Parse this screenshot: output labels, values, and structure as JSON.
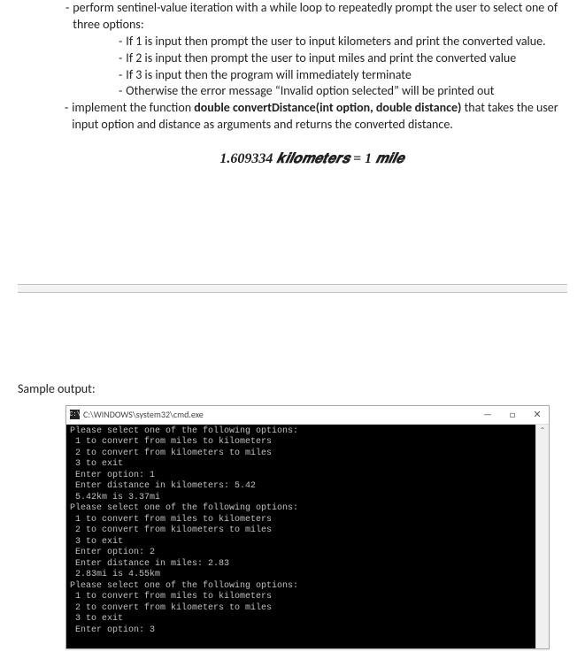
{
  "instructions": {
    "main1": "perform sentinel-value iteration with a while loop to repeatedly prompt the user to select one of three options:",
    "sub1": "If 1 is input then prompt the user to input kilometers and print the converted value.",
    "sub2": "If 2 is input then prompt the user to input miles and print the converted value",
    "sub3": "If 3 is input then the program will immediately terminate",
    "sub4": "Otherwise the error message “Invalid option selected” will be printed out",
    "main2_prefix": "implement the function ",
    "main2_bold": "double convertDistance(int option, double distance)",
    "main2_suffix": " that takes the user input option and distance as arguments and returns the converted distance."
  },
  "formula": "1.609334 𝒌𝒊𝒍𝒐𝒎𝒆𝒕𝒆𝒓𝒔 = 1 𝒎𝒊𝒍𝒆",
  "sample_label": "Sample output:",
  "console": {
    "icon_text": "C:\\",
    "title": "C:\\WINDOWS\\system32\\cmd.exe",
    "minimize": "—",
    "maximize": "□",
    "close": "✕",
    "scroll_up": "⌃",
    "lines": [
      "Please select one of the following options:",
      " 1 to convert from miles to kilometers",
      " 2 to convert from kilometers to miles",
      " 3 to exit",
      " Enter option: 1",
      " Enter distance in kilometers: 5.42",
      " 5.42km is 3.37mi",
      "Please select one of the following options:",
      " 1 to convert from miles to kilometers",
      " 2 to convert from kilometers to miles",
      " 3 to exit",
      " Enter option: 2",
      " Enter distance in miles: 2.83",
      " 2.83mi is 4.55km",
      "Please select one of the following options:",
      " 1 to convert from miles to kilometers",
      " 2 to convert from kilometers to miles",
      " 3 to exit",
      " Enter option: 3"
    ]
  }
}
